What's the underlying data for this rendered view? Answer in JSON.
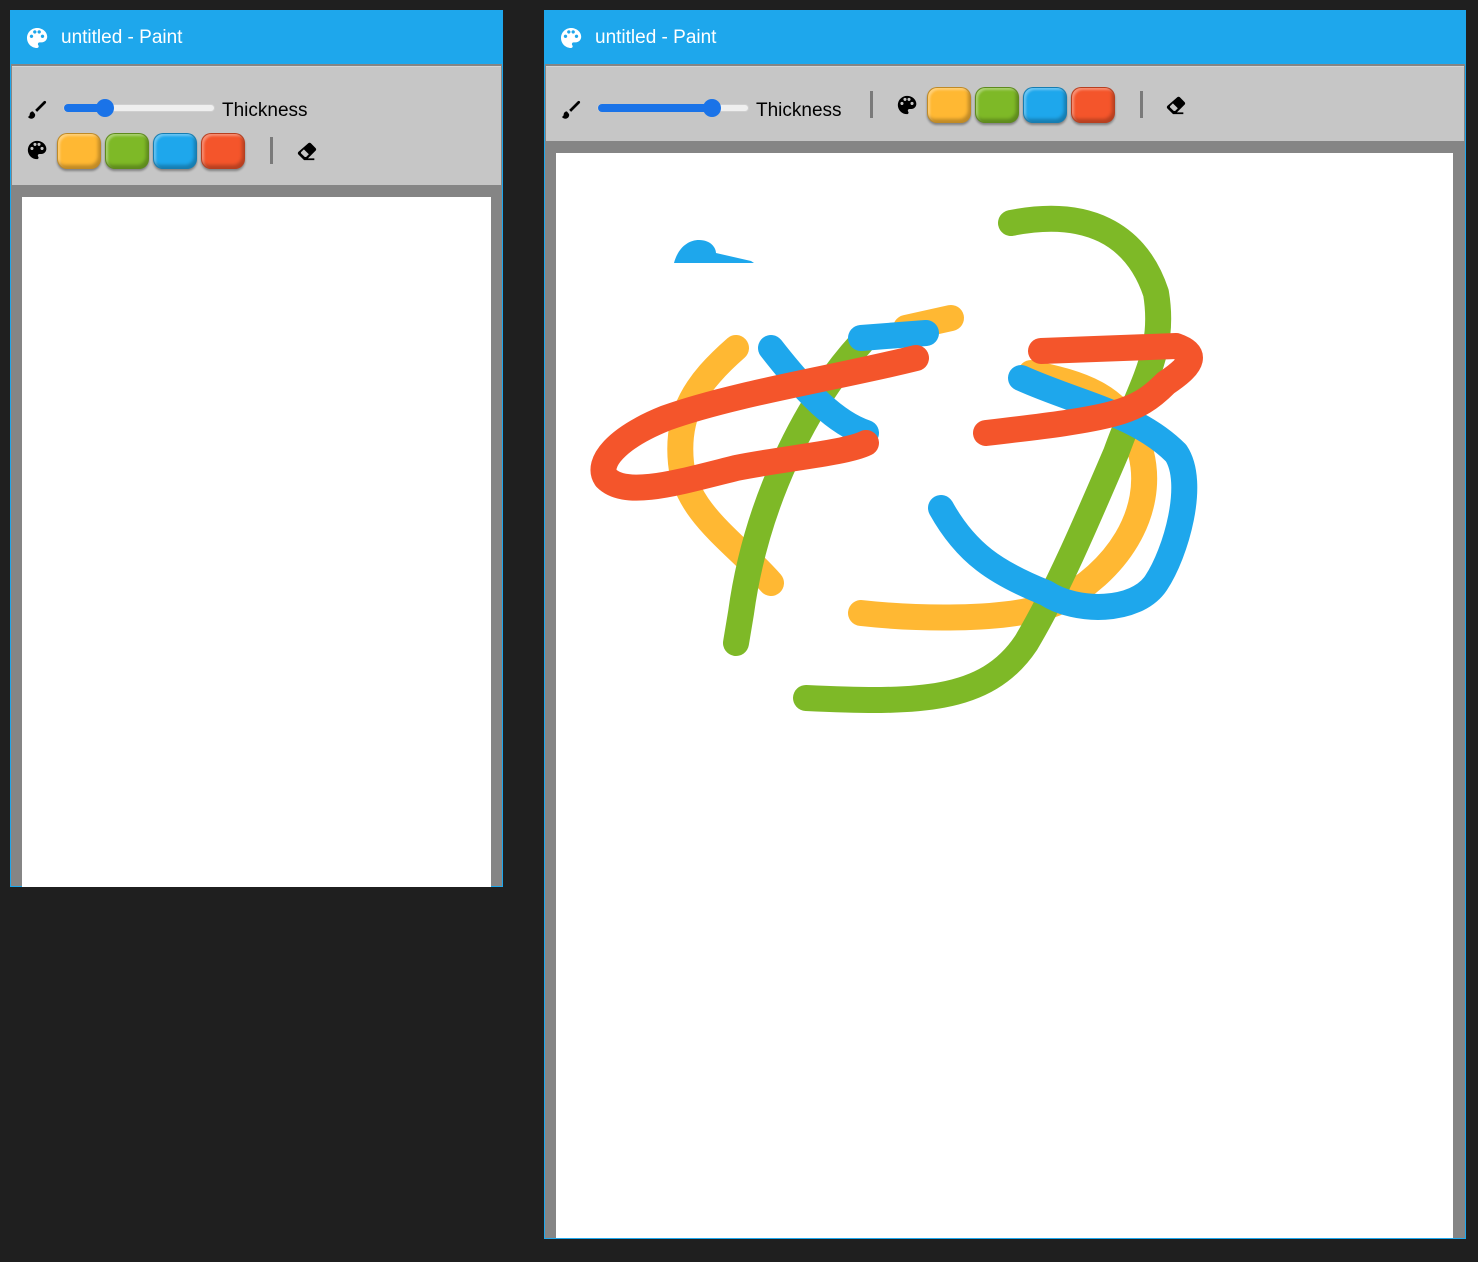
{
  "windows": [
    {
      "title": "untitled - Paint",
      "thickness_label": "Thickness",
      "thickness_level": 0.27,
      "palette": [
        "#ffb833",
        "#7eb927",
        "#1ea7ec",
        "#f4552b"
      ],
      "icons": [
        "palette-icon",
        "brush-icon",
        "palette-icon",
        "eraser-icon"
      ]
    },
    {
      "title": "untitled - Paint",
      "thickness_label": "Thickness",
      "thickness_level": 0.76,
      "palette": [
        "#ffb833",
        "#7eb927",
        "#1ea7ec",
        "#f4552b"
      ],
      "icons": [
        "palette-icon",
        "brush-icon",
        "palette-icon",
        "eraser-icon"
      ]
    }
  ],
  "colors": {
    "accent": "#1ea7ec",
    "toolbar": "#c6c6c6",
    "desktop": "#1f1f1f",
    "slider": "#1a73e8"
  }
}
